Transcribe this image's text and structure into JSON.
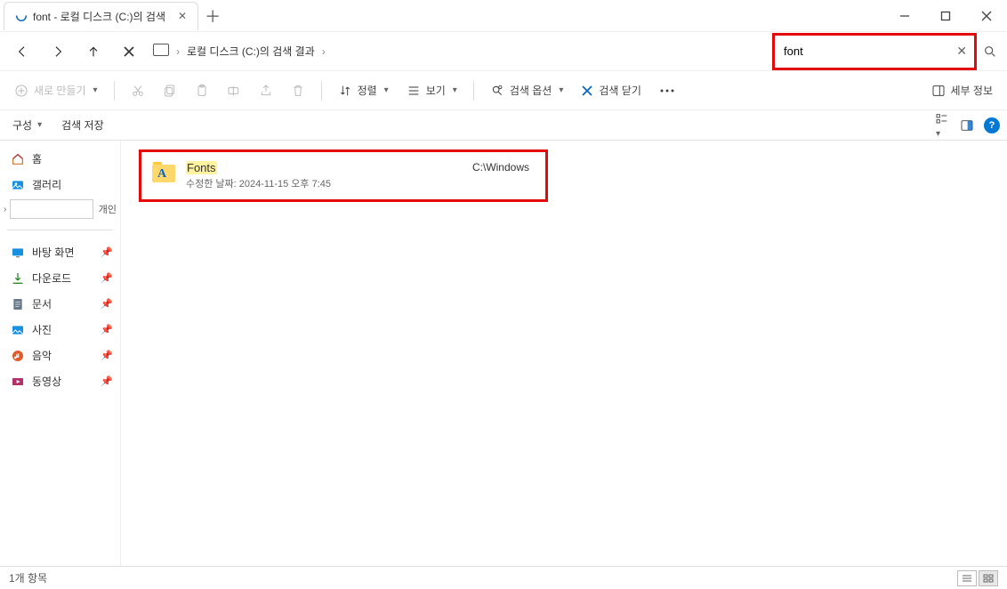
{
  "titlebar": {
    "tab_title": "font - 로컬 디스크 (C:)의 검색"
  },
  "nav": {
    "breadcrumb": "로컬 디스크 (C:)의 검색 결과"
  },
  "search": {
    "value": "font"
  },
  "toolbar": {
    "new": "새로 만들기",
    "sort": "정렬",
    "view": "보기",
    "search_options": "검색 옵션",
    "close_search": "검색 닫기",
    "details": "세부 정보"
  },
  "secbar": {
    "organize": "구성",
    "save_search": "검색 저장"
  },
  "sidebar": {
    "home": "홈",
    "gallery": "갤러리",
    "current_suffix": "개인",
    "desktop": "바탕 화면",
    "downloads": "다운로드",
    "documents": "문서",
    "pictures": "사진",
    "music": "음악",
    "videos": "동영상"
  },
  "result": {
    "name": "Fonts",
    "meta_label": "수정한 날짜:",
    "meta_value": "2024-11-15 오후 7:45",
    "path": "C:\\Windows"
  },
  "status": {
    "count": "1개 항목"
  }
}
